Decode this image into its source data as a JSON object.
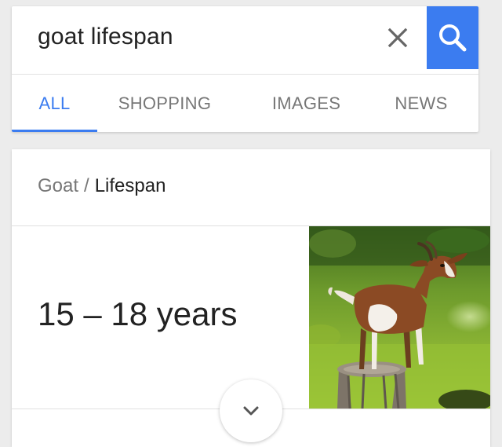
{
  "search": {
    "query": "goat lifespan",
    "clear_icon": "close-icon",
    "search_icon": "search-icon",
    "accent_color": "#3b7cf0"
  },
  "tabs": [
    {
      "label": "ALL",
      "active": true
    },
    {
      "label": "SHOPPING",
      "active": false
    },
    {
      "label": "IMAGES",
      "active": false
    },
    {
      "label": "NEWS",
      "active": false
    }
  ],
  "answer": {
    "breadcrumb": {
      "parent": "Goat",
      "separator": "/",
      "current": "Lifespan"
    },
    "value": "15 – 18 years",
    "image_subject": "goat standing on a tree stump",
    "expand_icon": "chevron-down-icon"
  }
}
